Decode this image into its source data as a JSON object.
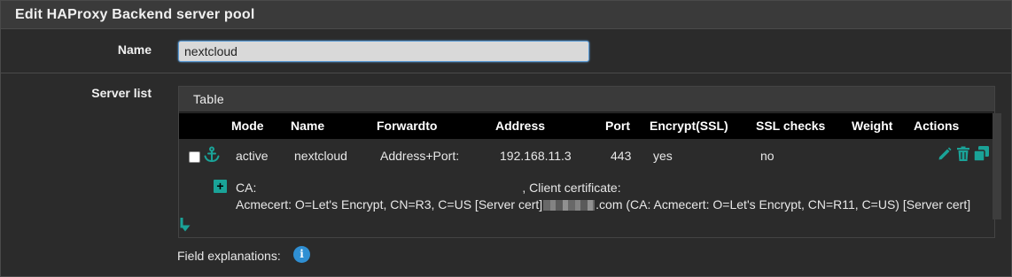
{
  "panel": {
    "title": "Edit HAProxy Backend server pool"
  },
  "name_field": {
    "label": "Name",
    "value": "nextcloud"
  },
  "server_list": {
    "label": "Server list",
    "table_title": "Table",
    "columns": [
      "Mode",
      "Name",
      "Forwardto",
      "Address",
      "Port",
      "Encrypt(SSL)",
      "SSL checks",
      "Weight",
      "Actions"
    ],
    "rows": [
      {
        "mode": "active",
        "name": "nextcloud",
        "forwardto": "Address+Port:",
        "address": "192.168.11.3",
        "port": "443",
        "encrypt": "yes",
        "ssl_checks": "no",
        "weight": "",
        "details_line1_prefix": "CA:",
        "details_line1_suffix": ", Client certificate:",
        "details_line2_prefix": "Acmecert: O=Let's Encrypt, CN=R3, C=US [Server cert]",
        "details_line2_suffix": ".com (CA: Acmecert: O=Let's Encrypt, CN=R11, C=US) [Server cert]"
      }
    ]
  },
  "field_explanations": {
    "label": "Field explanations:",
    "info_glyph": "i"
  },
  "colors": {
    "accent": "#1aa398",
    "info": "#2f8fd3",
    "header_bg": "#3a3a3a",
    "table_head_bg": "#000000"
  },
  "icons": [
    "anchor-icon",
    "plus-icon",
    "pencil-icon",
    "trash-icon",
    "copy-icon",
    "arrow-down-icon",
    "info-icon"
  ]
}
